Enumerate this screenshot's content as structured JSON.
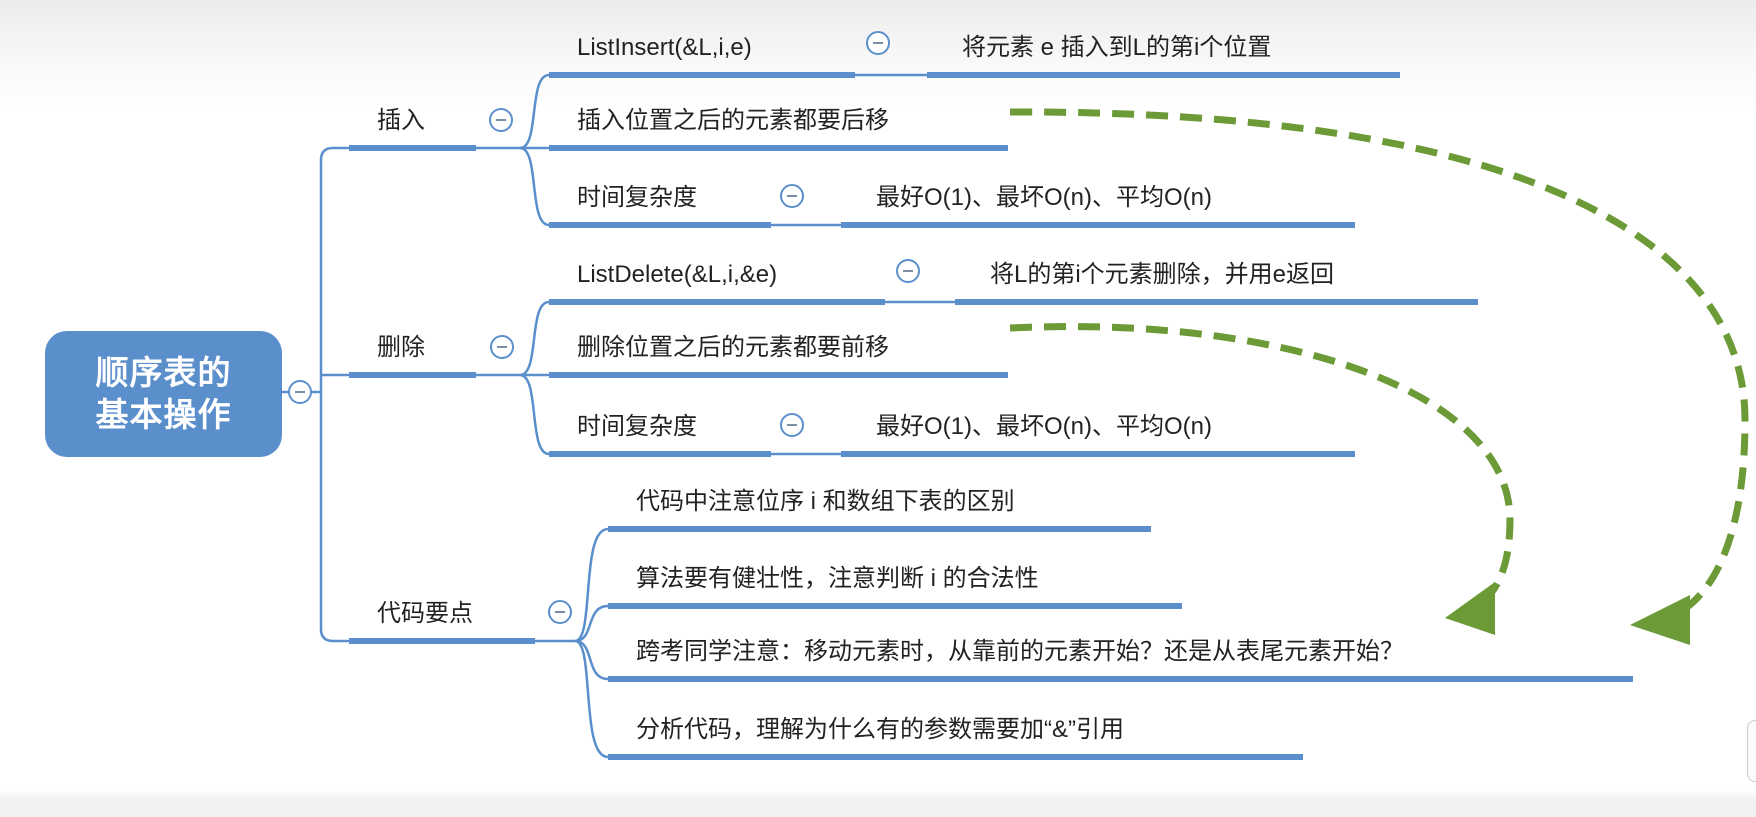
{
  "root": {
    "line1": "顺序表的",
    "line2": "基本操作"
  },
  "branches": {
    "insert": {
      "label": "插入",
      "children": {
        "func": {
          "label": "ListInsert(&L,i,e)",
          "detail": "将元素 e 插入到L的第i个位置"
        },
        "shift": {
          "label": "插入位置之后的元素都要后移"
        },
        "complexity": {
          "label": "时间复杂度",
          "detail": "最好O(1)、最坏O(n)、平均O(n)"
        }
      }
    },
    "delete": {
      "label": "删除",
      "children": {
        "func": {
          "label": "ListDelete(&L,i,&e)",
          "detail": "将L的第i个元素删除，并用e返回"
        },
        "shift": {
          "label": "删除位置之后的元素都要前移"
        },
        "complexity": {
          "label": "时间复杂度",
          "detail": "最好O(1)、最坏O(n)、平均O(n)"
        }
      }
    },
    "code": {
      "label": "代码要点",
      "children": [
        "代码中注意位序 i 和数组下表的区别",
        "算法要有健壮性，注意判断 i 的合法性",
        "跨考同学注意：移动元素时，从靠前的元素开始？还是从表尾元素开始？",
        "分析代码，理解为什么有的参数需要加“&”引用"
      ]
    }
  },
  "colors": {
    "node": "#5b8fcc",
    "arrow": "#6b9a36"
  }
}
